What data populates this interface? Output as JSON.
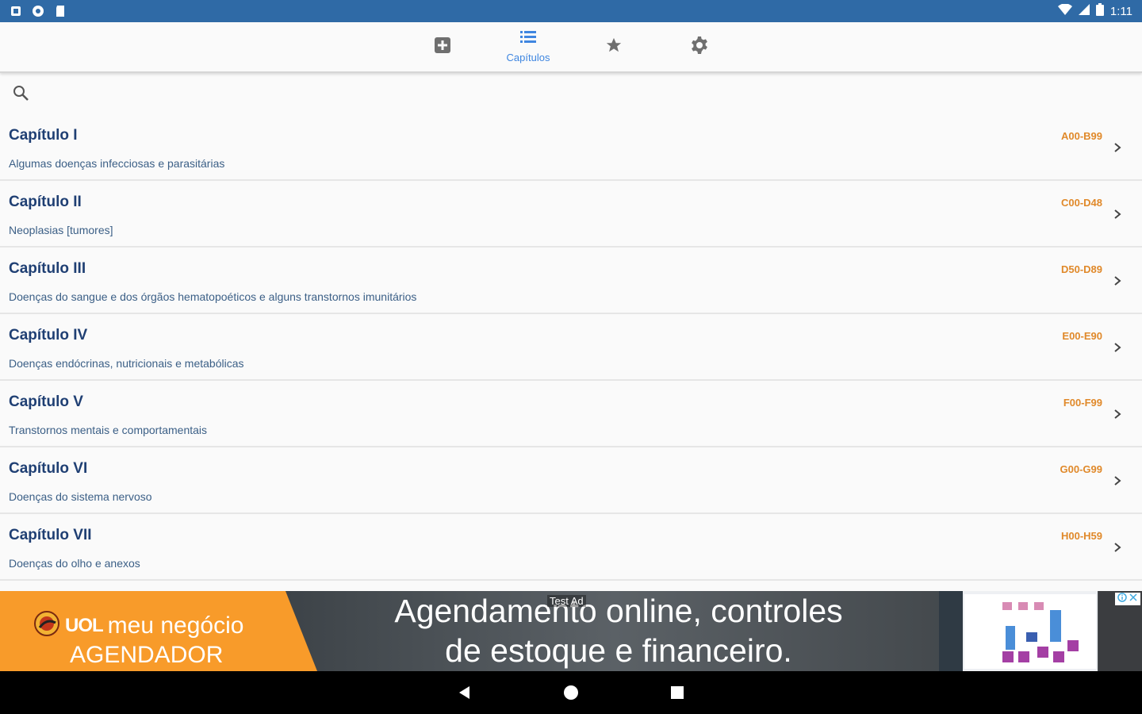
{
  "status_bar": {
    "time": "1:11"
  },
  "tabs": [
    {
      "icon": "plus-box-icon",
      "label": ""
    },
    {
      "icon": "list-icon",
      "label": "Capítulos"
    },
    {
      "icon": "star-icon",
      "label": ""
    },
    {
      "icon": "gear-icon",
      "label": ""
    }
  ],
  "search": {
    "placeholder": ""
  },
  "chapters": [
    {
      "title": "Capítulo I",
      "description": "Algumas doenças infecciosas e parasitárias",
      "code": "A00-B99"
    },
    {
      "title": "Capítulo II",
      "description": "Neoplasias [tumores]",
      "code": "C00-D48"
    },
    {
      "title": "Capítulo III",
      "description": "Doenças do sangue e dos órgãos hematopoéticos e alguns transtornos imunitários",
      "code": "D50-D89"
    },
    {
      "title": "Capítulo IV",
      "description": "Doenças endócrinas, nutricionais e metabólicas",
      "code": "E00-E90"
    },
    {
      "title": "Capítulo V",
      "description": "Transtornos mentais e comportamentais",
      "code": "F00-F99"
    },
    {
      "title": "Capítulo VI",
      "description": "Doenças do sistema nervoso",
      "code": "G00-G99"
    },
    {
      "title": "Capítulo VII",
      "description": "Doenças do olho e anexos",
      "code": "H00-H59"
    }
  ],
  "ad": {
    "brand": "UOL",
    "brand_sub": "meu negócio",
    "product": "AGENDADOR",
    "headline_line1": "Agendamento online, controles",
    "headline_line2": "de estoque e financeiro.",
    "test_label": "Test Ad"
  },
  "colors": {
    "status_bar": "#2f6aa6",
    "accent": "#3f86e0",
    "title": "#1f3f73",
    "code": "#e0892a",
    "ad_orange": "#f89b2a"
  }
}
